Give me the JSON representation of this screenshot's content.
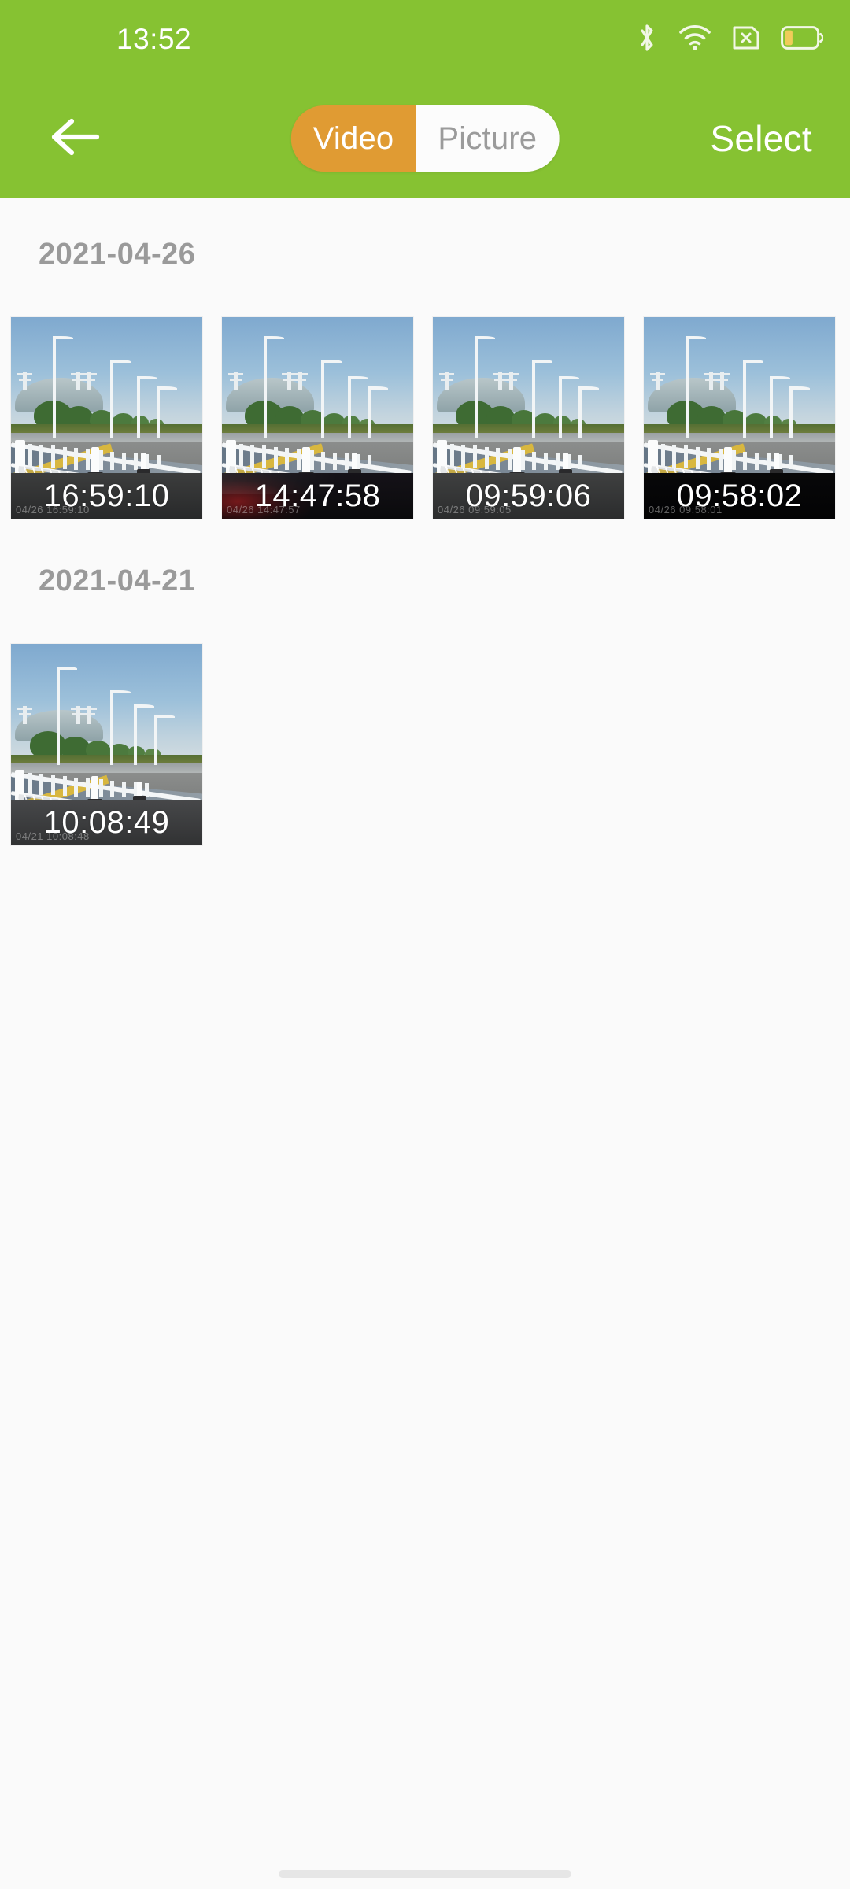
{
  "status_bar": {
    "time": "13:52",
    "icons": [
      {
        "name": "bluetooth-icon",
        "label": "Bluetooth"
      },
      {
        "name": "wifi-icon",
        "label": "Wi-Fi"
      },
      {
        "name": "no-sim-icon",
        "label": "No SIM"
      },
      {
        "name": "battery-icon",
        "label": "Battery low"
      }
    ],
    "background_color": "#86c232",
    "foreground_color": "#ffffff"
  },
  "toolbar": {
    "back_label": "Back",
    "select_label": "Select",
    "segments": [
      {
        "label": "Video",
        "active": true
      },
      {
        "label": "Picture",
        "active": false
      }
    ],
    "active_segment_color": "#e09b33",
    "inactive_segment_color": "#fcfcfc",
    "inactive_text_color": "#9b9b9b"
  },
  "content": {
    "background_color": "#fafafa",
    "date_text_color": "#9a9a9a",
    "groups": [
      {
        "date": "2021-04-26",
        "items": [
          {
            "time": "16:59:10",
            "osd": "04/26 16:59:10"
          },
          {
            "time": "14:47:58",
            "osd": "04/26 14:47:57"
          },
          {
            "time": "09:59:06",
            "osd": "04/26 09:59:05"
          },
          {
            "time": "09:58:02",
            "osd": "04/26 09:58:01"
          }
        ]
      },
      {
        "date": "2021-04-21",
        "items": [
          {
            "time": "10:08:49",
            "osd": "04/21 10:08:48"
          }
        ]
      }
    ]
  },
  "navigation": {
    "gesture_bar_color": "#e6e6e6"
  }
}
